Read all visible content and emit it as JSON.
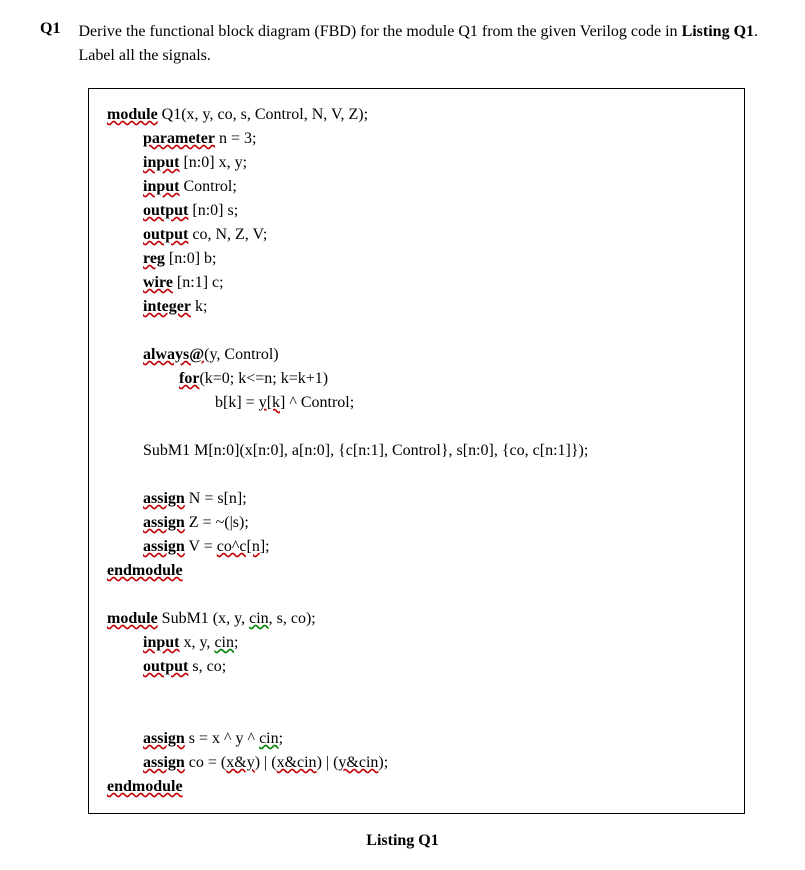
{
  "question": {
    "label": "Q1",
    "text_before": "Derive the functional block diagram (FBD) for the module Q1 from the given Verilog code in ",
    "listing_ref": "Listing Q1",
    "text_after": ". Label all the signals."
  },
  "caption": "Listing Q1",
  "code": {
    "l01": {
      "kw": "module",
      "rest": " Q1(x, y, co, s, Control, N, V, Z);"
    },
    "l02": {
      "kw": "parameter",
      "rest": " n = 3;"
    },
    "l03": {
      "kw": "input",
      "rest": " [n:0] x, y;"
    },
    "l04": {
      "kw": "input",
      "rest": " Control;"
    },
    "l05": {
      "kw": "output",
      "rest": " [n:0] s;"
    },
    "l06": {
      "kw": "output",
      "rest": " co, N, Z, V;"
    },
    "l07": {
      "kw": "reg",
      "rest": " [n:0] b;"
    },
    "l08": {
      "kw": "wire",
      "rest": " [n:1] c;"
    },
    "l09": {
      "kw": "integer",
      "rest": " k;"
    },
    "l10": {
      "kw": "always@",
      "rest": "(y, Control)"
    },
    "l11": {
      "kw": "for",
      "rest": "(k=0; k<=n; k=k+1)"
    },
    "l12": {
      "pre": "b[k] = ",
      "sq": "y[k",
      "post": "] ^ Control;"
    },
    "l13": "SubM1 M[n:0](x[n:0], a[n:0], {c[n:1], Control}, s[n:0], {co, c[n:1]});",
    "l14": {
      "kw": "assign",
      "rest": " N = s[n];"
    },
    "l15": {
      "kw": "assign",
      "rest": " Z = ~(|s);"
    },
    "l16": {
      "kw": "assign",
      "pre": " V = ",
      "sq": "co^c[n",
      "post": "];"
    },
    "l17": {
      "kw": "endmodule"
    },
    "l18": {
      "kw": "module",
      "rest": " SubM1 (x, y, ",
      "grn": "cin",
      "post": ", s, co);"
    },
    "l19": {
      "kw": "input",
      "rest": " x, y, ",
      "grn": "cin",
      "post": ";"
    },
    "l20": {
      "kw": "output",
      "rest": " s, co;"
    },
    "l21": {
      "kw": "assign",
      "rest": " s = x ^ y ^ ",
      "grn": "cin",
      "post": ";"
    },
    "l22": {
      "kw": "assign",
      "rest": " co = (",
      "sq1": "x&y",
      "mid1": ") | (",
      "sq2": "x&cin",
      "mid2": ") | (",
      "sq3": "y&cin",
      "post": ");"
    },
    "l23": {
      "kw": "endmodule"
    }
  }
}
